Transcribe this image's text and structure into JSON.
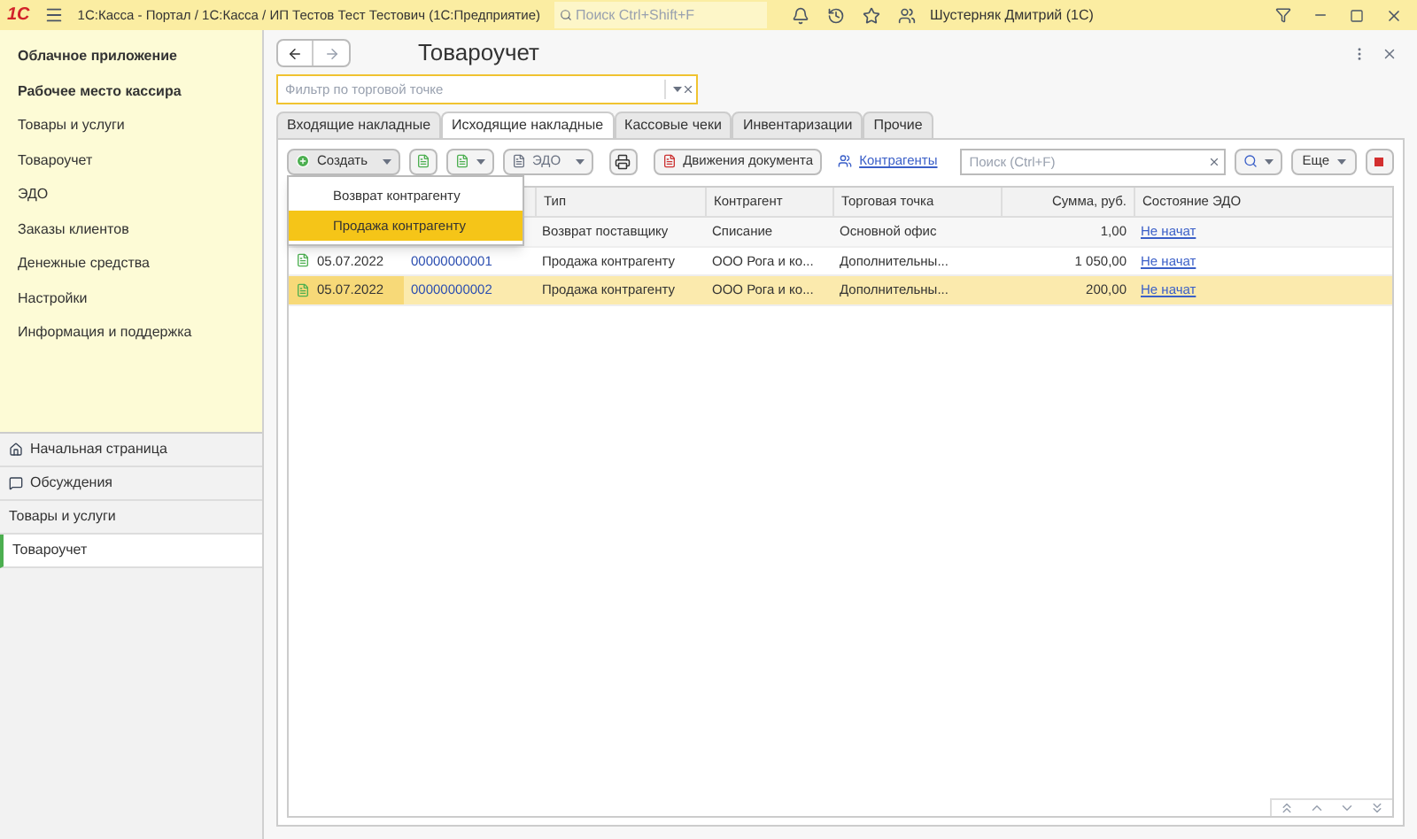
{
  "title_bar": {
    "logo": "1С",
    "title": "1С:Касса - Портал / 1С:Касса / ИП Тестов Тест Тестович  (1С:Предприятие)",
    "search_placeholder": "Поиск Ctrl+Shift+F",
    "user": "Шустерняк Дмитрий (1С)"
  },
  "sidebar": {
    "items": [
      {
        "label": "Облачное приложение",
        "bold": true
      },
      {
        "label": "Рабочее место кассира",
        "bold": true
      },
      {
        "label": "Товары и услуги",
        "bold": false
      },
      {
        "label": "Товароучет",
        "bold": false
      },
      {
        "label": "ЭДО",
        "bold": false
      },
      {
        "label": "Заказы клиентов",
        "bold": false
      },
      {
        "label": "Денежные средства",
        "bold": false
      },
      {
        "label": "Настройки",
        "bold": false
      },
      {
        "label": "Информация и поддержка",
        "bold": false
      }
    ],
    "open_windows": [
      {
        "label": "Начальная страница",
        "kind": "home",
        "selected": false
      },
      {
        "label": "Обсуждения",
        "kind": "chat",
        "selected": false
      },
      {
        "label": "Товары и услуги",
        "kind": "plain",
        "selected": false
      },
      {
        "label": "Товароучет",
        "kind": "plain",
        "selected": true
      }
    ]
  },
  "form": {
    "title": "Товароучет",
    "filter_placeholder": "Фильтр по торговой точке",
    "tabs": [
      {
        "label": "Входящие накладные",
        "selected": false
      },
      {
        "label": "Исходящие накладные",
        "selected": true
      },
      {
        "label": "Кассовые чеки",
        "selected": false
      },
      {
        "label": "Инвентаризации",
        "selected": false
      },
      {
        "label": "Прочие",
        "selected": false
      }
    ],
    "toolbar": {
      "create": "Создать",
      "edo": "ЭДО",
      "movements": "Движения документа",
      "counterparties": "Контрагенты",
      "search_placeholder": "Поиск (Ctrl+F)",
      "more": "Еще"
    },
    "create_menu": [
      {
        "label": "Возврат контрагенту",
        "selected": false
      },
      {
        "label": "Продажа контрагенту",
        "selected": true
      }
    ],
    "table": {
      "columns": [
        "Тип",
        "Контрагент",
        "Торговая точка",
        "Сумма, руб.",
        "Состояние ЭДО"
      ],
      "rows": [
        {
          "type": "Возврат поставщику",
          "counterparty": "Списание",
          "point": "Основной офис",
          "sum": "1,00",
          "edo_state": "Не начат",
          "selected": false
        },
        {
          "date": "05.07.2022",
          "number": "00000000001",
          "type": "Продажа контрагенту",
          "counterparty": "ООО Рога и ко...",
          "point": "Дополнительны...",
          "sum": "1 050,00",
          "edo_state": "Не начат",
          "selected": false
        },
        {
          "date": "05.07.2022",
          "number": "00000000002",
          "type": "Продажа контрагенту",
          "counterparty": "ООО Рога и ко...",
          "point": "Дополнительны...",
          "sum": "200,00",
          "edo_state": "Не начат",
          "selected": true
        }
      ]
    }
  }
}
